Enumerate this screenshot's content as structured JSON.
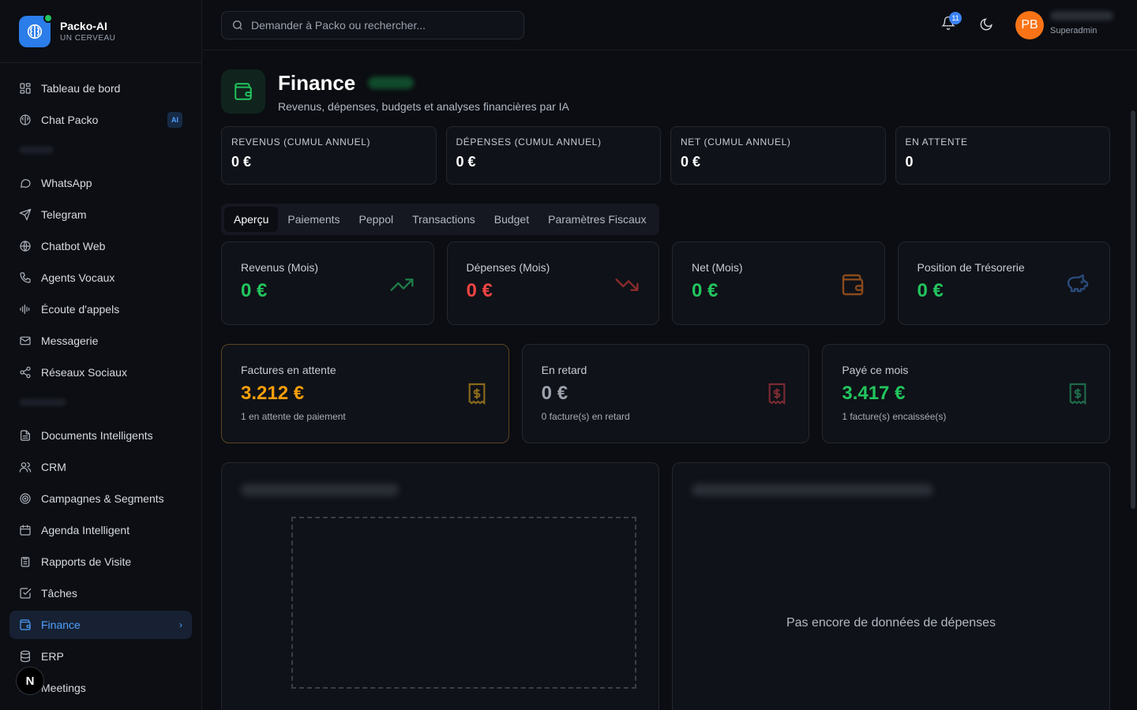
{
  "brand": {
    "name": "Packo-AI",
    "subtitle": "UN CERVEAU"
  },
  "sidebar": {
    "items": [
      {
        "label": "Tableau de bord",
        "icon": "dashboard-icon"
      },
      {
        "label": "Chat Packo",
        "icon": "brain-icon",
        "badge": "AI"
      },
      {
        "label": "WhatsApp",
        "icon": "message-circle-icon"
      },
      {
        "label": "Telegram",
        "icon": "send-icon"
      },
      {
        "label": "Chatbot Web",
        "icon": "globe-icon"
      },
      {
        "label": "Agents Vocaux",
        "icon": "phone-icon"
      },
      {
        "label": "Écoute d'appels",
        "icon": "audio-lines-icon"
      },
      {
        "label": "Messagerie",
        "icon": "mail-icon"
      },
      {
        "label": "Réseaux Sociaux",
        "icon": "share-icon"
      },
      {
        "label": "Documents Intelligents",
        "icon": "file-icon"
      },
      {
        "label": "CRM",
        "icon": "users-icon"
      },
      {
        "label": "Campagnes & Segments",
        "icon": "target-icon"
      },
      {
        "label": "Agenda Intelligent",
        "icon": "calendar-icon"
      },
      {
        "label": "Rapports de Visite",
        "icon": "clipboard-icon"
      },
      {
        "label": "Tâches",
        "icon": "check-square-icon"
      },
      {
        "label": "Finance",
        "icon": "wallet-icon",
        "active": true
      },
      {
        "label": "ERP",
        "icon": "database-icon"
      },
      {
        "label": "Meetings",
        "icon": "video-icon"
      }
    ],
    "fab_label": "N"
  },
  "topbar": {
    "search_placeholder": "Demander à Packo ou rechercher...",
    "notification_count": "11",
    "avatar_initials": "PB",
    "user_role": "Superadmin"
  },
  "page": {
    "title": "Finance",
    "subtitle": "Revenus, dépenses, budgets et analyses financières par IA"
  },
  "kpis": [
    {
      "label": "REVENUS (CUMUL ANNUEL)",
      "value": "0 €"
    },
    {
      "label": "DÉPENSES (CUMUL ANNUEL)",
      "value": "0 €"
    },
    {
      "label": "NET (CUMUL ANNUEL)",
      "value": "0 €"
    },
    {
      "label": "EN ATTENTE",
      "value": "0"
    }
  ],
  "tabs": [
    "Aperçu",
    "Paiements",
    "Peppol",
    "Transactions",
    "Budget",
    "Paramètres Fiscaux"
  ],
  "stats": [
    {
      "label": "Revenus (Mois)",
      "value": "0 €",
      "color": "#22c55e",
      "icon": "trending-up-icon"
    },
    {
      "label": "Dépenses (Mois)",
      "value": "0 €",
      "color": "#ef4444",
      "icon": "trending-down-icon"
    },
    {
      "label": "Net (Mois)",
      "value": "0 €",
      "color": "#22c55e",
      "icon": "wallet-icon"
    },
    {
      "label": "Position de Trésorerie",
      "value": "0 €",
      "color": "#22c55e",
      "icon": "piggy-bank-icon"
    }
  ],
  "invoices": [
    {
      "label": "Factures en attente",
      "value": "3.212 €",
      "note": "1 en attente de paiement",
      "color": "#f59e0b",
      "icon": "receipt-icon"
    },
    {
      "label": "En retard",
      "value": "0 €",
      "note": "0 facture(s) en retard",
      "color": "#9ca3af",
      "icon": "receipt-icon"
    },
    {
      "label": "Payé ce mois",
      "value": "3.417 €",
      "note": "1 facture(s) encaissée(s)",
      "color": "#22c55e",
      "icon": "receipt-icon"
    }
  ],
  "expenses_panel": {
    "empty_text": "Pas encore de données de dépenses"
  },
  "colors": {
    "accent": "#4ea1ff",
    "positive": "#22c55e",
    "negative": "#ef4444",
    "warning": "#f59e0b"
  }
}
